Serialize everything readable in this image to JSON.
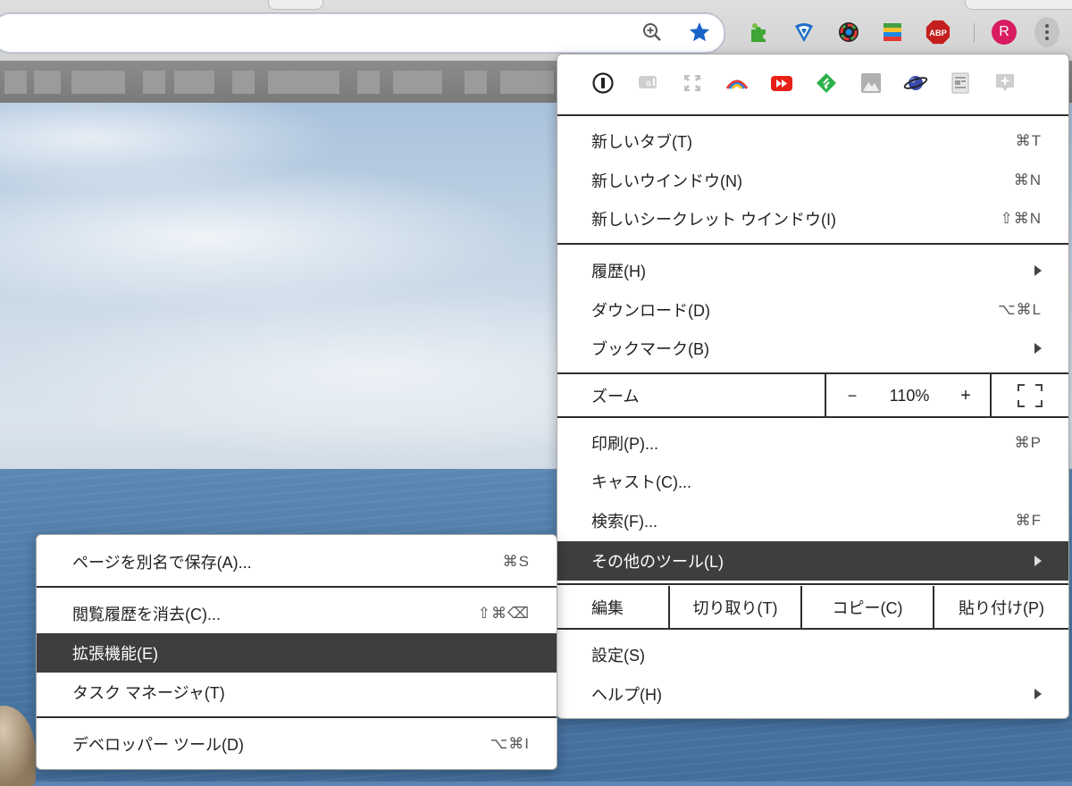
{
  "toolbar": {
    "avatar_letter": "R",
    "adblock_label": "ABP"
  },
  "main_menu": {
    "new_tab": {
      "label": "新しいタブ(T)",
      "shortcut": "⌘T"
    },
    "new_window": {
      "label": "新しいウインドウ(N)",
      "shortcut": "⌘N"
    },
    "new_incognito": {
      "label": "新しいシークレット ウインドウ(I)",
      "shortcut": "⇧⌘N"
    },
    "history": {
      "label": "履歴(H)"
    },
    "downloads": {
      "label": "ダウンロード(D)",
      "shortcut": "⌥⌘L"
    },
    "bookmarks": {
      "label": "ブックマーク(B)"
    },
    "zoom": {
      "label": "ズーム",
      "minus": "−",
      "value": "110%",
      "plus": "+"
    },
    "print": {
      "label": "印刷(P)...",
      "shortcut": "⌘P"
    },
    "cast": {
      "label": "キャスト(C)..."
    },
    "find": {
      "label": "検索(F)...",
      "shortcut": "⌘F"
    },
    "more_tools": {
      "label": "その他のツール(L)"
    },
    "edit": {
      "label": "編集",
      "cut": "切り取り(T)",
      "copy": "コピー(C)",
      "paste": "貼り付け(P)"
    },
    "settings": {
      "label": "設定(S)"
    },
    "help": {
      "label": "ヘルプ(H)"
    }
  },
  "more_tools_menu": {
    "save_page": {
      "label": "ページを別名で保存(A)...",
      "shortcut": "⌘S"
    },
    "clear_browsing": {
      "label": "閲覧履歴を消去(C)...",
      "shortcut": "⇧⌘⌫"
    },
    "extensions": {
      "label": "拡張機能(E)"
    },
    "task_manager": {
      "label": "タスク マネージャ(T)"
    },
    "developer_tools": {
      "label": "デベロッパー ツール(D)",
      "shortcut": "⌥⌘I"
    }
  },
  "colors": {
    "highlight": "#3e3e3e",
    "star": "#1a62c8",
    "adblock": "#c41e1e",
    "avatar": "#d81b60"
  }
}
